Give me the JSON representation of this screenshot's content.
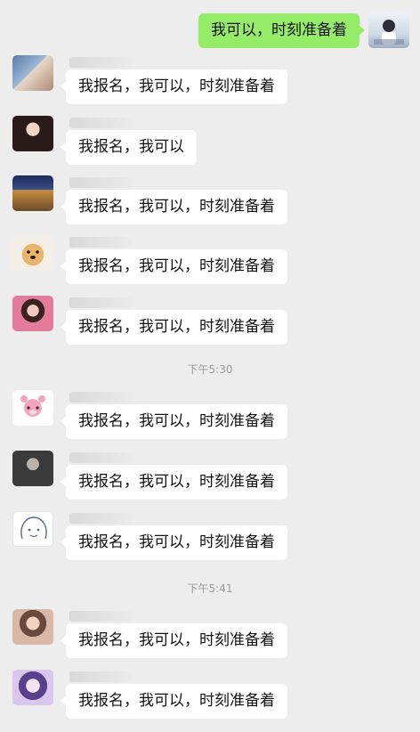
{
  "outgoing": {
    "text": "我可以，时刻准备着"
  },
  "messages": [
    {
      "text": "我报名，我可以，时刻准备着",
      "avatar": "avatar-girl-couple"
    },
    {
      "text": "我报名，我可以",
      "avatar": "avatar-dark-hair-girl"
    },
    {
      "text": "我报名，我可以，时刻准备着",
      "avatar": "avatar-night-painting"
    },
    {
      "text": "我报名，我可以，时刻准备着",
      "avatar": "avatar-shiba-dog"
    },
    {
      "text": "我报名，我可以，时刻准备着",
      "avatar": "avatar-girl-pink"
    },
    {
      "text": "我报名，我可以，时刻准备着",
      "avatar": "avatar-pink-bear"
    },
    {
      "text": "我报名，我可以，时刻准备着",
      "avatar": "avatar-dark-figure"
    },
    {
      "text": "我报名，我可以，时刻准备着",
      "avatar": "avatar-line-drawing"
    },
    {
      "text": "我报名，我可以，时刻准备着",
      "avatar": "avatar-girl-portrait"
    },
    {
      "text": "我报名，我可以，时刻准备着",
      "avatar": "avatar-anime-girl"
    }
  ],
  "timestamps": [
    "下午5:30",
    "下午5:41"
  ],
  "colors": {
    "background": "#ededed",
    "outgoing_bubble": "#95ec69",
    "incoming_bubble": "#ffffff",
    "timestamp": "#9a9a9a"
  }
}
